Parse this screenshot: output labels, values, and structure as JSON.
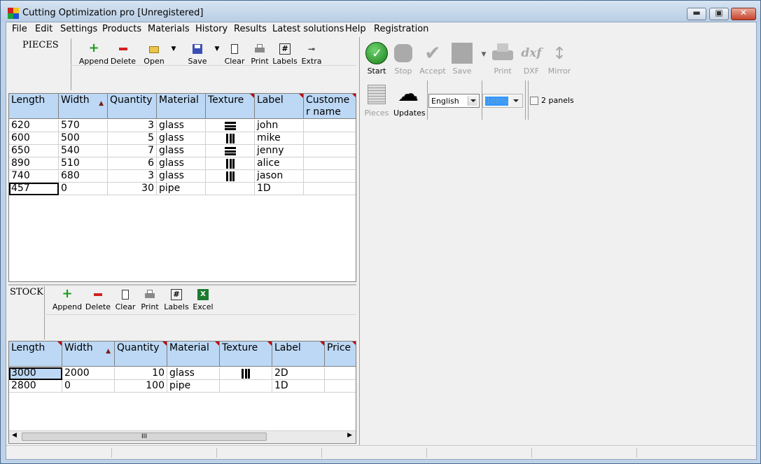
{
  "window": {
    "title": "Cutting Optimization pro [Unregistered]"
  },
  "menu": [
    "File",
    "Edit",
    "Settings",
    "Products",
    "Materials",
    "History",
    "Results",
    "Latest solutions",
    "Help",
    "Registration"
  ],
  "pieces": {
    "label": "PIECES",
    "toolbar": [
      "Append",
      "Delete",
      "Open",
      "Save",
      "Clear",
      "Print",
      "Labels",
      "Extra"
    ],
    "columns": [
      "Length",
      "Width",
      "Quantity",
      "Material",
      "Texture",
      "Label",
      "Custome r name"
    ],
    "rows": [
      [
        "620",
        "570",
        "3",
        "glass",
        "h",
        "john",
        ""
      ],
      [
        "600",
        "500",
        "5",
        "glass",
        "v",
        "mike",
        ""
      ],
      [
        "650",
        "540",
        "7",
        "glass",
        "h",
        "jenny",
        ""
      ],
      [
        "890",
        "510",
        "6",
        "glass",
        "v",
        "alice",
        ""
      ],
      [
        "740",
        "680",
        "3",
        "glass",
        "v",
        "jason",
        ""
      ],
      [
        "457",
        "0",
        "30",
        "pipe",
        "",
        "1D",
        ""
      ]
    ]
  },
  "stock": {
    "label": "STOCK",
    "toolbar": [
      "Append",
      "Delete",
      "Clear",
      "Print",
      "Labels",
      "Excel"
    ],
    "columns": [
      "Length",
      "Width",
      "Quantity",
      "Material",
      "Texture",
      "Label",
      "Price"
    ],
    "rows": [
      [
        "3000",
        "2000",
        "10",
        "glass",
        "v",
        "2D",
        ""
      ],
      [
        "2800",
        "0",
        "100",
        "pipe",
        "",
        "1D",
        ""
      ]
    ],
    "scroll_glyph": "III"
  },
  "right": {
    "buttons": [
      "Start",
      "Stop",
      "Accept",
      "Save",
      "Print",
      "DXF",
      "Mirror"
    ],
    "buttons2": [
      "Pieces",
      "Updates"
    ],
    "language": "English",
    "zoom": "100%",
    "two_panels_label": "2 panels"
  }
}
